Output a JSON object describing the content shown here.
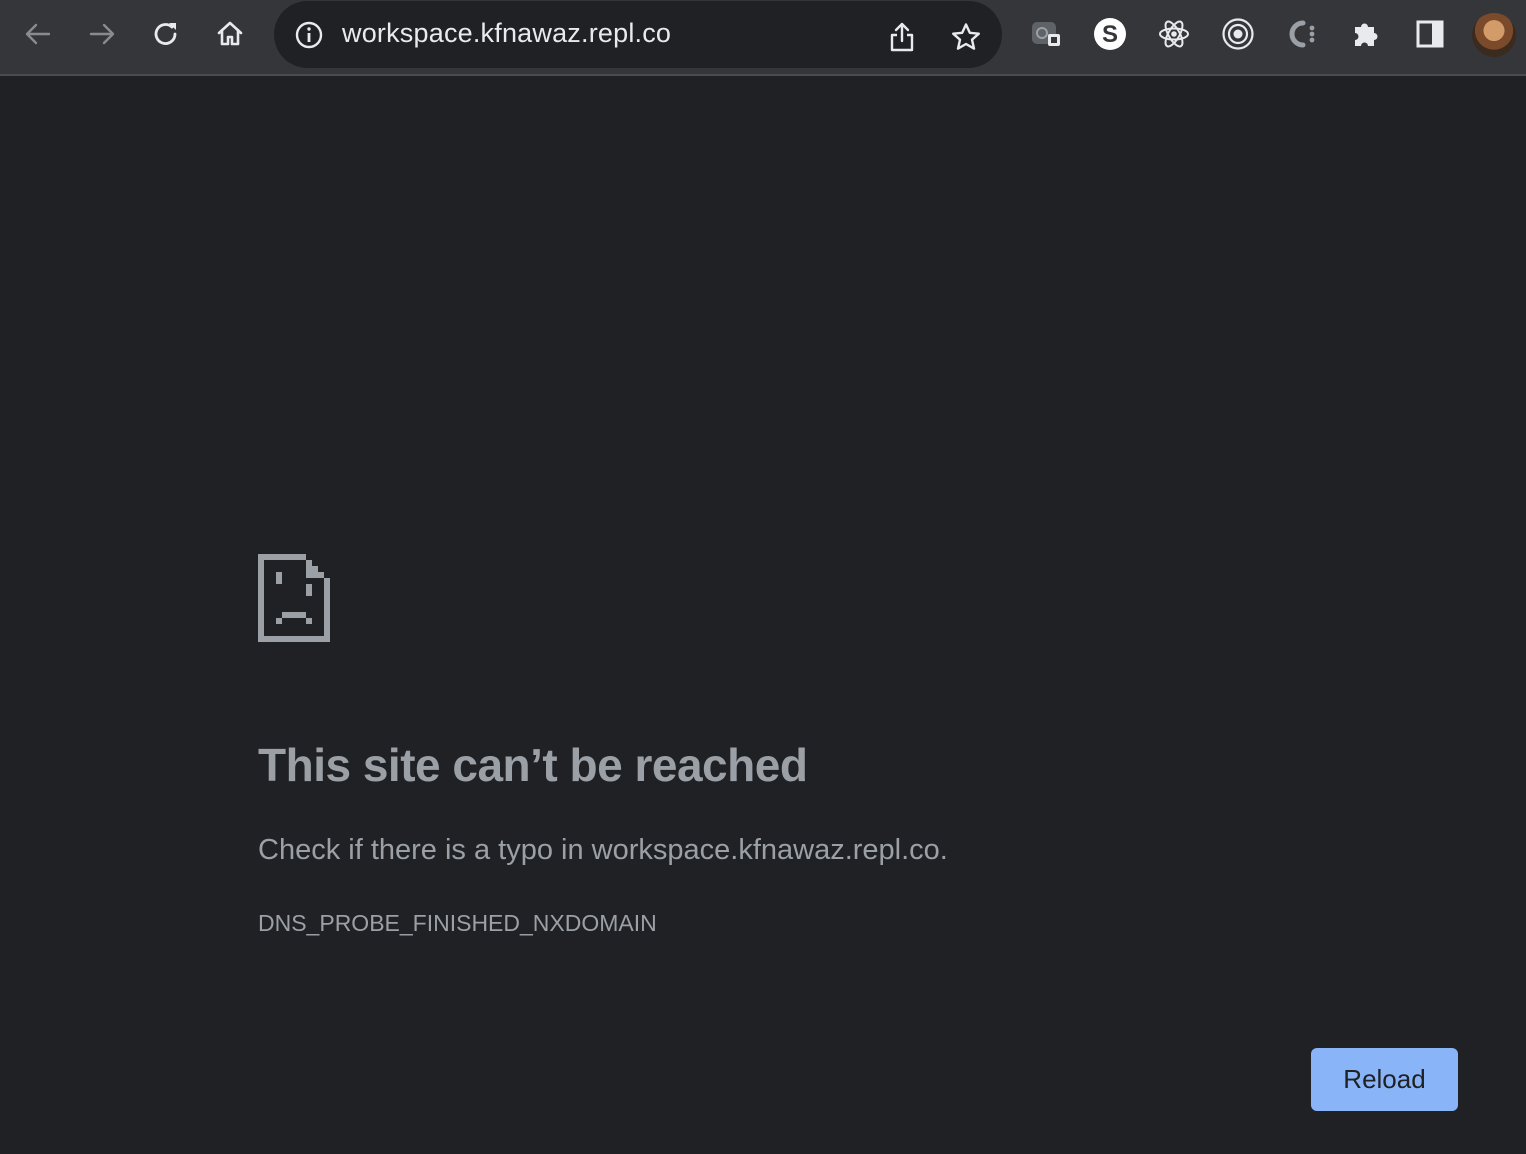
{
  "browser": {
    "url": "workspace.kfnawaz.repl.co",
    "nav": {
      "back_icon": "back-arrow-icon",
      "forward_icon": "forward-arrow-icon",
      "reload_icon": "reload-icon",
      "home_icon": "home-icon"
    },
    "omnibox_icons": [
      "site-info-icon",
      "share-icon",
      "bookmark-star-icon"
    ],
    "extensions": [
      "screen-recorder-extension-icon",
      "s-extension-icon",
      "react-devtools-icon",
      "target-extension-icon",
      "c-extension-icon",
      "puzzle-extensions-icon",
      "side-panel-icon"
    ],
    "profile_icon": "profile-avatar"
  },
  "error_page": {
    "icon": "sad-document-icon",
    "headline": "This site can’t be reached",
    "message": "Check if there is a typo in workspace.kfnawaz.repl.co.",
    "error_code": "DNS_PROBE_FINISHED_NXDOMAIN",
    "reload_label": "Reload"
  },
  "colors": {
    "page_bg": "#202124",
    "toolbar_bg": "#35363a",
    "text_muted": "#9aa0a6",
    "button_accent": "#8ab4f8"
  }
}
